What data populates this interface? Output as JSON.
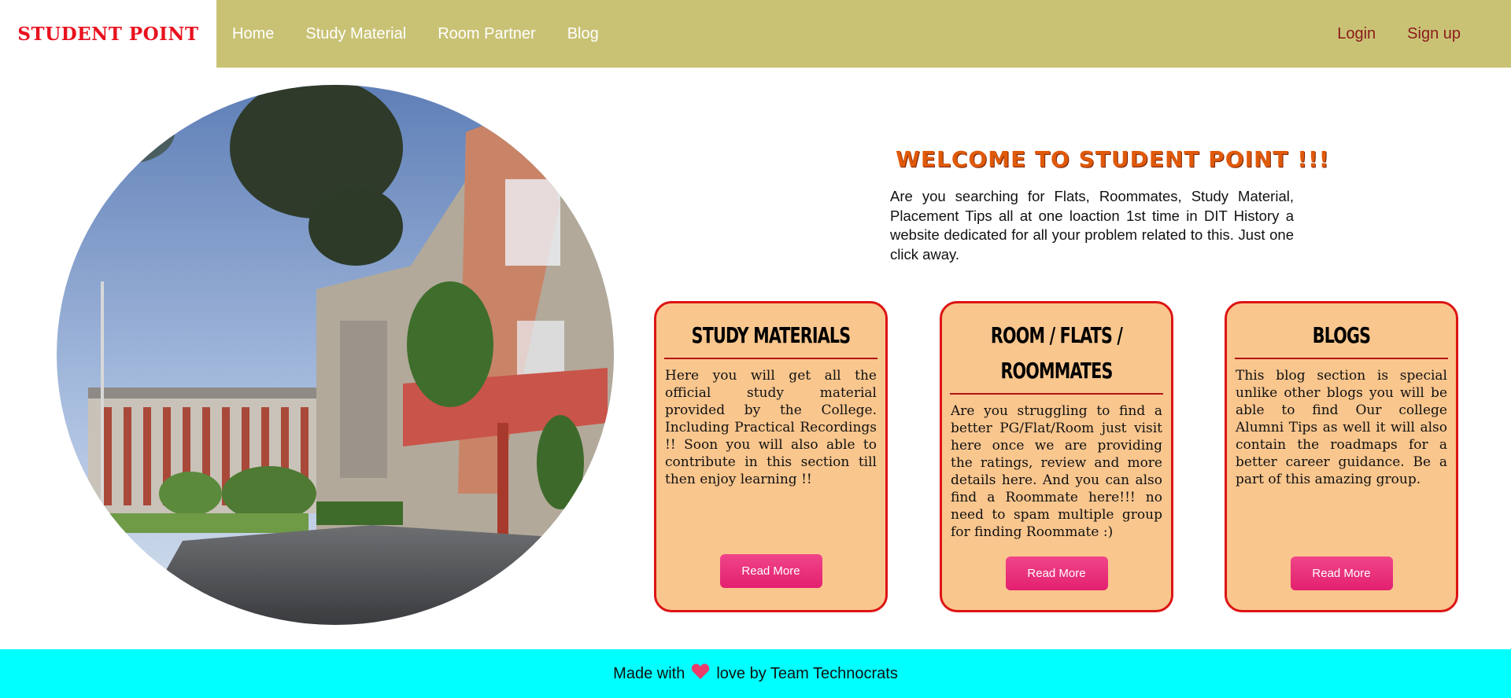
{
  "header": {
    "brand": "STUDENT POINT",
    "nav": [
      "Home",
      "Study Material",
      "Room Partner",
      "Blog"
    ],
    "login": "Login",
    "signup": "Sign up"
  },
  "hero": {
    "title": "WELCOME TO STUDENT POINT !!!",
    "text": "Are you searching for Flats, Roommates, Study Material, Placement Tips all at one loaction 1st time in DIT History a website dedicated for all your problem related to this. Just one click away."
  },
  "cards": [
    {
      "title": "STUDY MATERIALS",
      "text": "Here you will get all the official study material provided by the College. Including Practical Recordings !! Soon you will also able to contribute in this section till then enjoy learning !!",
      "button": "Read More"
    },
    {
      "title": "ROOM / FLATS / ROOMMATES",
      "text": "Are you struggling to find a better PG/Flat/Room just visit here once we are providing the ratings, review and more details here. And you can also find a Roommate here!!! no need to spam multiple group for finding Roommate :)",
      "button": "Read More"
    },
    {
      "title": "BLOGS",
      "text": "This blog section is special unlike other blogs you will be able to find Our college Alumni Tips as well it will also contain the roadmaps for a better career guidance. Be a part of this amazing group.",
      "button": "Read More"
    }
  ],
  "footer": {
    "before": "Made with",
    "after": "love by Team Technocrats",
    "heart_icon": "heart-icon"
  },
  "colors": {
    "header_bg": "#c9c275",
    "brand": "#e8121e",
    "card_bg": "#f9c68e",
    "card_border": "#dd1414",
    "button": "#e3206f",
    "footer_bg": "#00ffff"
  }
}
